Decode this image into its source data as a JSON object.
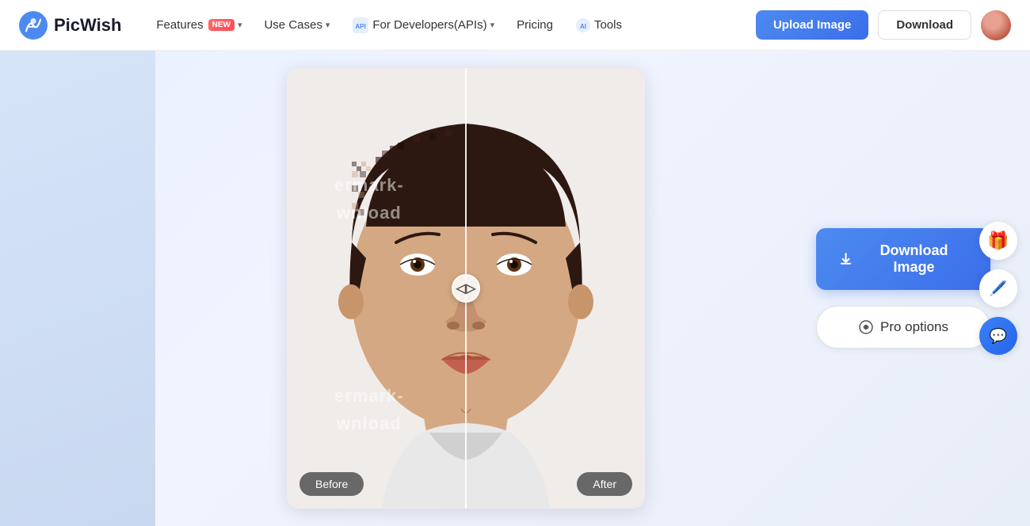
{
  "brand": {
    "name": "PicWish",
    "logo_color": "#4d8af0"
  },
  "nav": {
    "features_label": "Features",
    "features_badge": "NEW",
    "use_cases_label": "Use Cases",
    "api_icon": "API",
    "for_developers_label": "For Developers(APIs)",
    "ai_icon": "AI",
    "pricing_label": "Pricing",
    "tools_label": "Tools",
    "upload_label": "Upload Image",
    "download_label": "Download"
  },
  "comparison": {
    "before_label": "Before",
    "after_label": "After",
    "watermark_line1": "ermark",
    "watermark_line2": "wnload"
  },
  "actions": {
    "download_image_label": "Download Image",
    "pro_options_label": "Pro options"
  },
  "floating": {
    "gift_icon": "🎁",
    "chat_edit_icon": "✏️",
    "chat_icon": "💬"
  }
}
